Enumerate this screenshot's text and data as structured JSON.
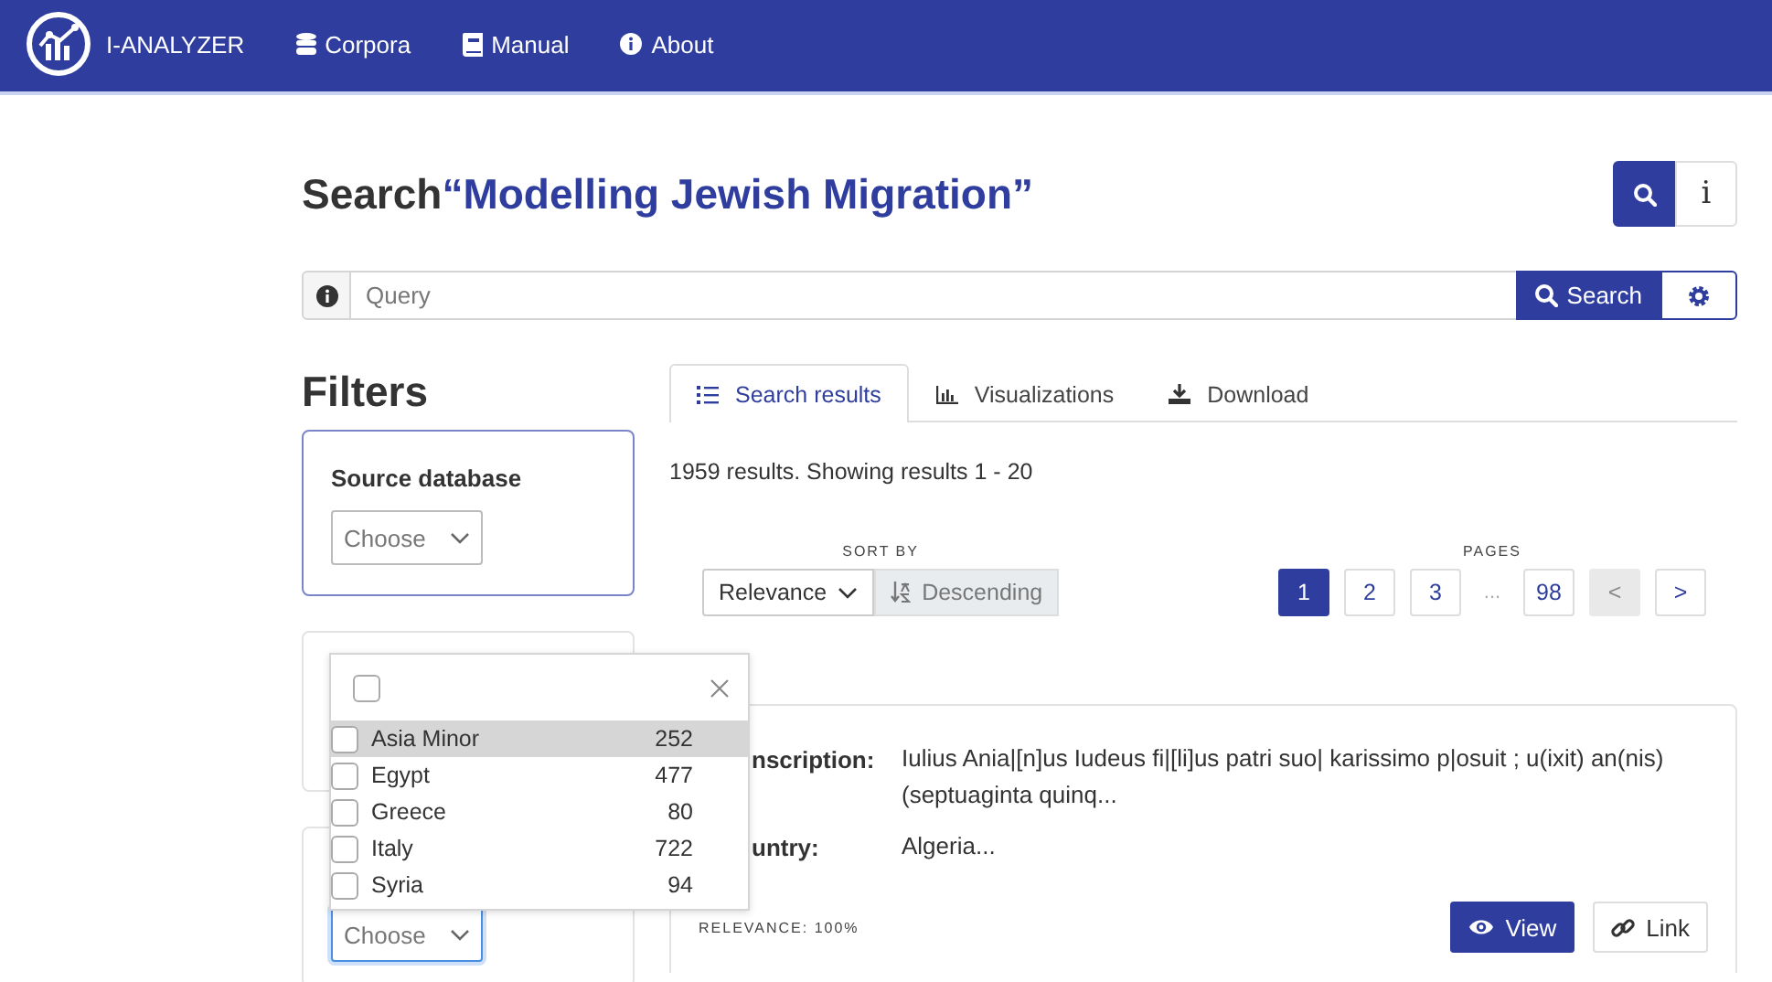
{
  "navbar": {
    "brand": "I-ANALYZER",
    "links": [
      {
        "label": "Corpora"
      },
      {
        "label": "Manual"
      },
      {
        "label": "About"
      }
    ]
  },
  "header": {
    "prefix": "Search",
    "corpus": "“Modelling Jewish Migration”",
    "info_button": "i"
  },
  "query": {
    "placeholder": "Query",
    "search_button": "Search"
  },
  "filters": {
    "heading": "Filters",
    "cards": [
      {
        "kind": "select",
        "title": "Source database",
        "select": "Choose",
        "focused": false
      },
      {
        "kind": "blank"
      },
      {
        "kind": "select",
        "select": "Choose",
        "focused": true
      }
    ]
  },
  "dropdown": {
    "select_all_checked": false,
    "options": [
      {
        "label": "Asia Minor",
        "count": "252",
        "checked": false,
        "highlighted": true
      },
      {
        "label": "Egypt",
        "count": "477",
        "checked": false,
        "highlighted": false
      },
      {
        "label": "Greece",
        "count": "80",
        "checked": false,
        "highlighted": false
      },
      {
        "label": "Italy",
        "count": "722",
        "checked": false,
        "highlighted": false
      },
      {
        "label": "Syria",
        "count": "94",
        "checked": false,
        "highlighted": false
      }
    ]
  },
  "tabs": [
    {
      "label": "Search results",
      "selected": true
    },
    {
      "label": "Visualizations",
      "selected": false
    },
    {
      "label": "Download",
      "selected": false
    }
  ],
  "results": {
    "summary": "1959 results. Showing results 1 - 20",
    "sort": {
      "label": "SORT BY",
      "field": "Relevance",
      "direction": "Descending"
    },
    "pagination": {
      "label": "PAGES",
      "items": [
        {
          "kind": "page",
          "label": "1",
          "selected": true,
          "disabled": false
        },
        {
          "kind": "page",
          "label": "2",
          "selected": false,
          "disabled": false
        },
        {
          "kind": "page",
          "label": "3",
          "selected": false,
          "disabled": false
        },
        {
          "kind": "ellipsis",
          "label": "..."
        },
        {
          "kind": "page",
          "label": "98",
          "selected": false,
          "disabled": false
        },
        {
          "kind": "page",
          "label": "<",
          "selected": false,
          "disabled": true
        },
        {
          "kind": "page",
          "label": ">",
          "selected": false,
          "disabled": false
        }
      ]
    },
    "cards": [
      {
        "fields": [
          {
            "label": "nscription:",
            "value": "Iulius Ania|[n]us Iudeus fi|[li]us patri suo| karissimo p|osuit ; u(ixit) an(nis) (septuaginta quinq..."
          },
          {
            "label": "untry:",
            "value": "Algeria..."
          }
        ],
        "relevance": "RELEVANCE: 100%",
        "view_button": "View",
        "link_button": "Link"
      }
    ]
  }
}
